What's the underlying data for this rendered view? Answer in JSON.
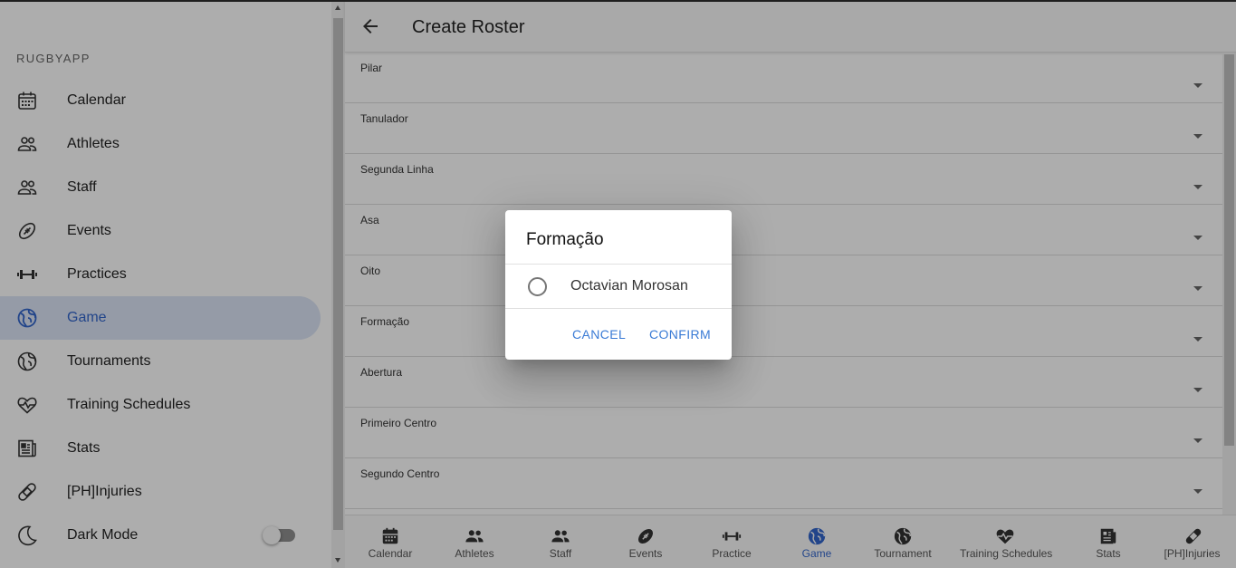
{
  "sidebar": {
    "app_title": "RUGBYAPP",
    "items": [
      {
        "label": "Calendar",
        "icon": "calendar-icon"
      },
      {
        "label": "Athletes",
        "icon": "people-icon"
      },
      {
        "label": "Staff",
        "icon": "people-icon"
      },
      {
        "label": "Events",
        "icon": "football-icon"
      },
      {
        "label": "Practices",
        "icon": "dumbbell-icon"
      },
      {
        "label": "Game",
        "icon": "globe-icon",
        "active": true
      },
      {
        "label": "Tournaments",
        "icon": "globe-icon"
      },
      {
        "label": "Training Schedules",
        "icon": "heart-pulse-icon"
      },
      {
        "label": "Stats",
        "icon": "newspaper-icon"
      },
      {
        "label": "[PH]Injuries",
        "icon": "bandage-icon"
      },
      {
        "label": "Dark Mode",
        "icon": "moon-icon"
      }
    ],
    "dark_mode_on": false
  },
  "header": {
    "back_icon": "arrow-back-icon",
    "title": "Create Roster"
  },
  "fields": [
    {
      "label": "Pilar"
    },
    {
      "label": "Tanulador"
    },
    {
      "label": "Segunda Linha"
    },
    {
      "label": "Asa"
    },
    {
      "label": "Oito"
    },
    {
      "label": "Formação"
    },
    {
      "label": "Abertura"
    },
    {
      "label": "Primeiro Centro"
    },
    {
      "label": "Segundo Centro"
    }
  ],
  "bottom_nav": [
    {
      "label": "Calendar",
      "icon": "calendar-icon"
    },
    {
      "label": "Athletes",
      "icon": "people-icon"
    },
    {
      "label": "Staff",
      "icon": "people-icon"
    },
    {
      "label": "Events",
      "icon": "football-icon"
    },
    {
      "label": "Practice",
      "icon": "dumbbell-icon"
    },
    {
      "label": "Game",
      "icon": "globe-icon",
      "active": true
    },
    {
      "label": "Tournament",
      "icon": "globe-icon"
    },
    {
      "label": "Training Schedules",
      "icon": "heart-pulse-icon"
    },
    {
      "label": "Stats",
      "icon": "newspaper-icon"
    },
    {
      "label": "[PH]Injuries",
      "icon": "bandage-icon"
    }
  ],
  "dialog": {
    "title": "Formação",
    "option": {
      "label": "Octavian Morosan",
      "selected": false
    },
    "cancel_label": "CANCEL",
    "confirm_label": "CONFIRM"
  },
  "colors": {
    "accent": "#3366cc",
    "active_bg": "#dce5f6",
    "dialog_button": "#3a7bd5"
  }
}
